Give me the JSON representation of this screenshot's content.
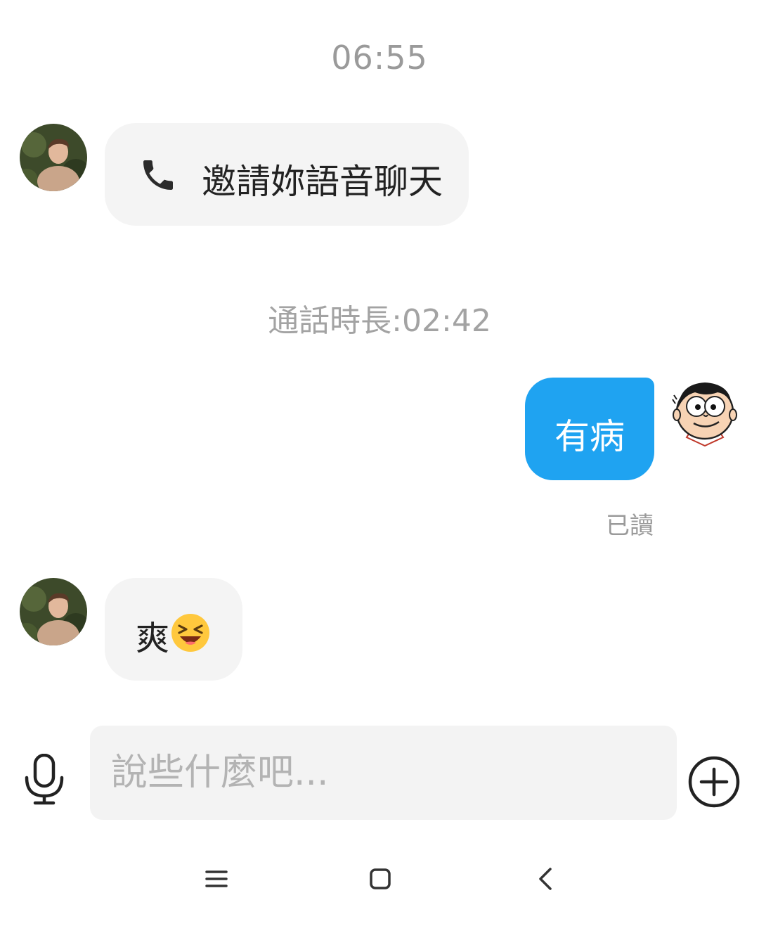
{
  "chat": {
    "time": "06:55",
    "call_message": "邀請妳語音聊天",
    "call_duration": "通話時長:02:42",
    "outgoing_message": "有病",
    "read_receipt": "已讀",
    "incoming_message": "爽",
    "incoming_emoji": "laughing-squinting-face-emoji"
  },
  "input": {
    "placeholder": "說些什麼吧..."
  },
  "icons": {
    "call": "phone-icon",
    "mic": "microphone-icon",
    "plus": "plus-circle-icon",
    "nav_menu": "menu-icon",
    "nav_home": "home-icon",
    "nav_back": "back-icon"
  },
  "colors": {
    "outgoing_bubble": "#1fa3f1",
    "incoming_bubble": "#f4f4f4",
    "timestamp_text": "#9a9a9a"
  }
}
